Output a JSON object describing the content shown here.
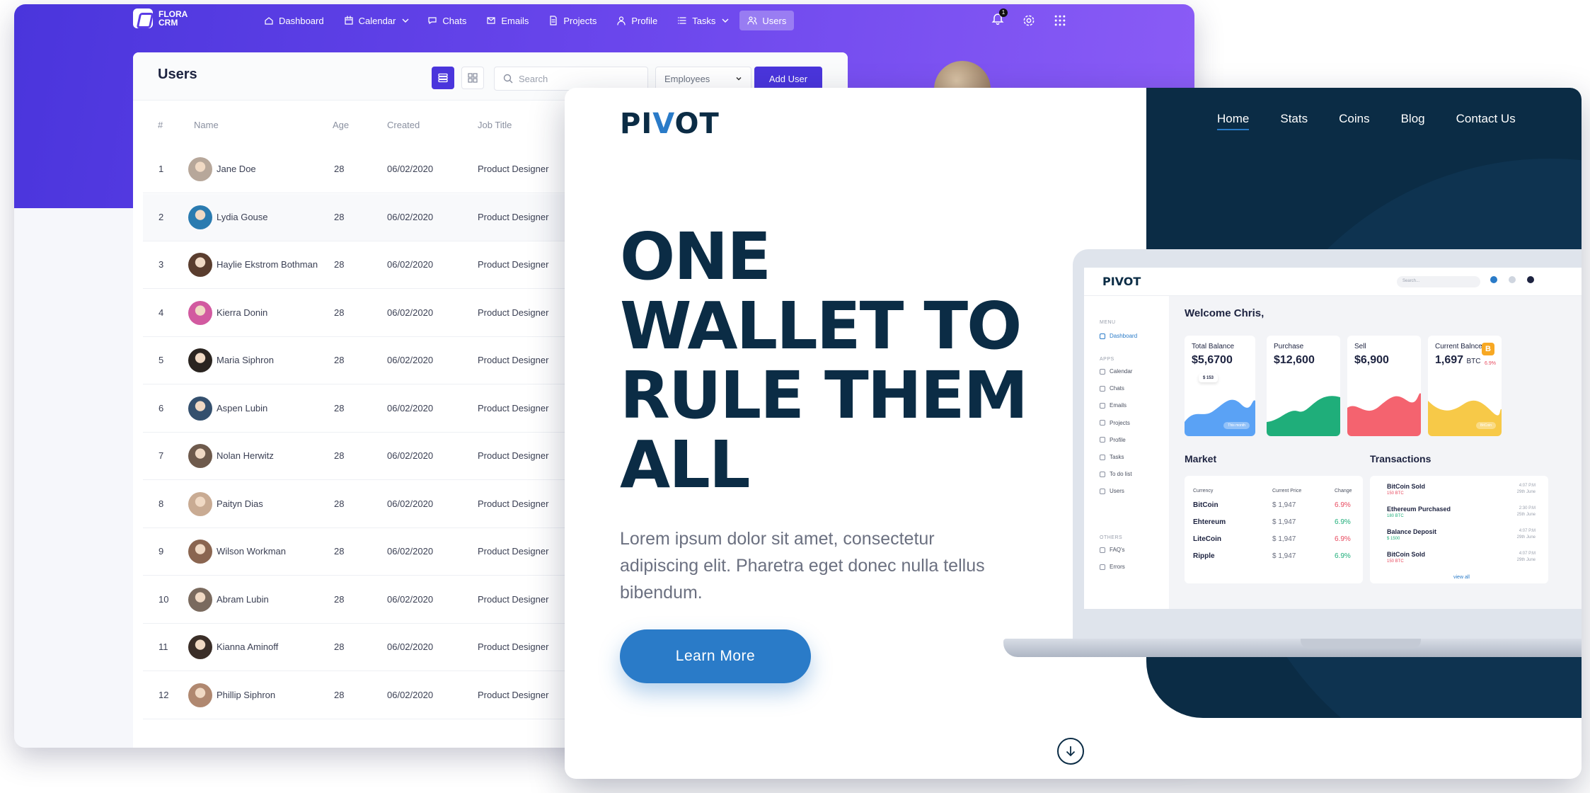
{
  "crm": {
    "brand": "FLORA CRM",
    "nav": [
      {
        "label": "Dashboard",
        "icon": "home-icon"
      },
      {
        "label": "Calendar",
        "icon": "calendar-icon",
        "dropdown": true
      },
      {
        "label": "Chats",
        "icon": "chat-icon"
      },
      {
        "label": "Emails",
        "icon": "mail-icon"
      },
      {
        "label": "Projects",
        "icon": "file-icon"
      },
      {
        "label": "Profile",
        "icon": "user-icon"
      },
      {
        "label": "Tasks",
        "icon": "list-icon",
        "dropdown": true
      },
      {
        "label": "Users",
        "icon": "users-icon",
        "active": true
      }
    ],
    "notification_count": "1",
    "page_title": "Users",
    "search_placeholder": "Search",
    "filter_value": "Employees",
    "add_label": "Add User",
    "columns": [
      "#",
      "Name",
      "Age",
      "Created",
      "Job Title"
    ],
    "rows": [
      {
        "n": "1",
        "name": "Jane Doe",
        "age": "28",
        "created": "06/02/2020",
        "job": "Product Designer",
        "avatar_color": "#b7a79a"
      },
      {
        "n": "2",
        "name": "Lydia Gouse",
        "age": "28",
        "created": "06/02/2020",
        "job": "Product Designer",
        "avatar_color": "#2a7bb0"
      },
      {
        "n": "3",
        "name": "Haylie Ekstrom Bothman",
        "age": "28",
        "created": "06/02/2020",
        "job": "Product Designer",
        "avatar_color": "#5a3d2e"
      },
      {
        "n": "4",
        "name": "Kierra Donin",
        "age": "28",
        "created": "06/02/2020",
        "job": "Product Designer",
        "avatar_color": "#d25aa0"
      },
      {
        "n": "5",
        "name": "Maria Siphron",
        "age": "28",
        "created": "06/02/2020",
        "job": "Product Designer",
        "avatar_color": "#2a2420"
      },
      {
        "n": "6",
        "name": "Aspen Lubin",
        "age": "28",
        "created": "06/02/2020",
        "job": "Product Designer",
        "avatar_color": "#34506e"
      },
      {
        "n": "7",
        "name": "Nolan Herwitz",
        "age": "28",
        "created": "06/02/2020",
        "job": "Product Designer",
        "avatar_color": "#6e5a4c"
      },
      {
        "n": "8",
        "name": "Paityn Dias",
        "age": "28",
        "created": "06/02/2020",
        "job": "Product Designer",
        "avatar_color": "#c9ab93"
      },
      {
        "n": "9",
        "name": "Wilson Workman",
        "age": "28",
        "created": "06/02/2020",
        "job": "Product Designer",
        "avatar_color": "#8a6550"
      },
      {
        "n": "10",
        "name": "Abram Lubin",
        "age": "28",
        "created": "06/02/2020",
        "job": "Product Designer",
        "avatar_color": "#7a6a5e"
      },
      {
        "n": "11",
        "name": "Kianna Aminoff",
        "age": "28",
        "created": "06/02/2020",
        "job": "Product Designer",
        "avatar_color": "#3a2e28"
      },
      {
        "n": "12",
        "name": "Phillip Siphron",
        "age": "28",
        "created": "06/02/2020",
        "job": "Product Designer",
        "avatar_color": "#b08870"
      }
    ]
  },
  "pivot": {
    "logo": "PIVOT",
    "nav": [
      {
        "label": "Home",
        "active": true
      },
      {
        "label": "Stats"
      },
      {
        "label": "Coins"
      },
      {
        "label": "Blog"
      },
      {
        "label": "Contact Us"
      }
    ],
    "headline": [
      "ONE",
      "WALLET TO",
      "RULE THEM",
      "ALL"
    ],
    "subtitle": "Lorem ipsum dolor sit amet, consectetur adipiscing elit. Pharetra eget donec nulla tellus bibendum.",
    "cta": "Learn More",
    "colors": {
      "navy": "#0b2c45",
      "blue": "#2a7bc8",
      "purple": "#4a35dc"
    },
    "dashboard": {
      "logo": "PIVOT",
      "search_placeholder": "Search...",
      "sections": {
        "menu": "MENU",
        "apps": "APPS",
        "others": "OTHERS"
      },
      "menu_items": [
        "Dashboard"
      ],
      "app_items": [
        "Calendar",
        "Chats",
        "Emails",
        "Projects",
        "Profile",
        "Tasks",
        "To do list",
        "Users"
      ],
      "other_items": [
        "FAQ's",
        "Errors"
      ],
      "welcome": "Welcome Chris,",
      "kpis": [
        {
          "label": "Total Balance",
          "value": "$5,6700",
          "color": "#5aa2f5",
          "tooltip": "$ 153",
          "pill": "This month"
        },
        {
          "label": "Purchase",
          "value": "$12,600",
          "color": "#1fae7a"
        },
        {
          "label": "Sell",
          "value": "$6,900",
          "color": "#f4636f"
        },
        {
          "label": "Current Balnce",
          "value": "1,697",
          "unit": "BTC",
          "color": "#f7c948",
          "badge": "B",
          "change": "6.9%",
          "pill": "BitCoin"
        }
      ],
      "market_title": "Market",
      "market_columns": [
        "Currency",
        "Current Price",
        "Change"
      ],
      "market": [
        {
          "coin": "BitCoin",
          "price": "$ 1,947",
          "change": "6.9%",
          "up": false
        },
        {
          "coin": "Ehtereum",
          "price": "$ 1,947",
          "change": "6.9%",
          "up": true
        },
        {
          "coin": "LiteCoin",
          "price": "$ 1,947",
          "change": "6.9%",
          "up": false
        },
        {
          "coin": "Ripple",
          "price": "$ 1,947",
          "change": "6.9%",
          "up": true
        }
      ],
      "transactions_title": "Transactions",
      "transactions": [
        {
          "title": "BitCoin Sold",
          "sub": "150 BTC",
          "time": "4:07 P.M",
          "date": "29th June",
          "up": false
        },
        {
          "title": "Ethereum Purchased",
          "sub": "180 BTC",
          "time": "2:30 P.M",
          "date": "25th June",
          "up": true
        },
        {
          "title": "Balance Deposit",
          "sub": "$ 1500",
          "time": "4:07 P.M",
          "date": "29th June",
          "up": true
        },
        {
          "title": "BitCoin Sold",
          "sub": "150 BTC",
          "time": "4:07 P.M",
          "date": "29th June",
          "up": false
        }
      ],
      "view_all": "view all"
    }
  }
}
